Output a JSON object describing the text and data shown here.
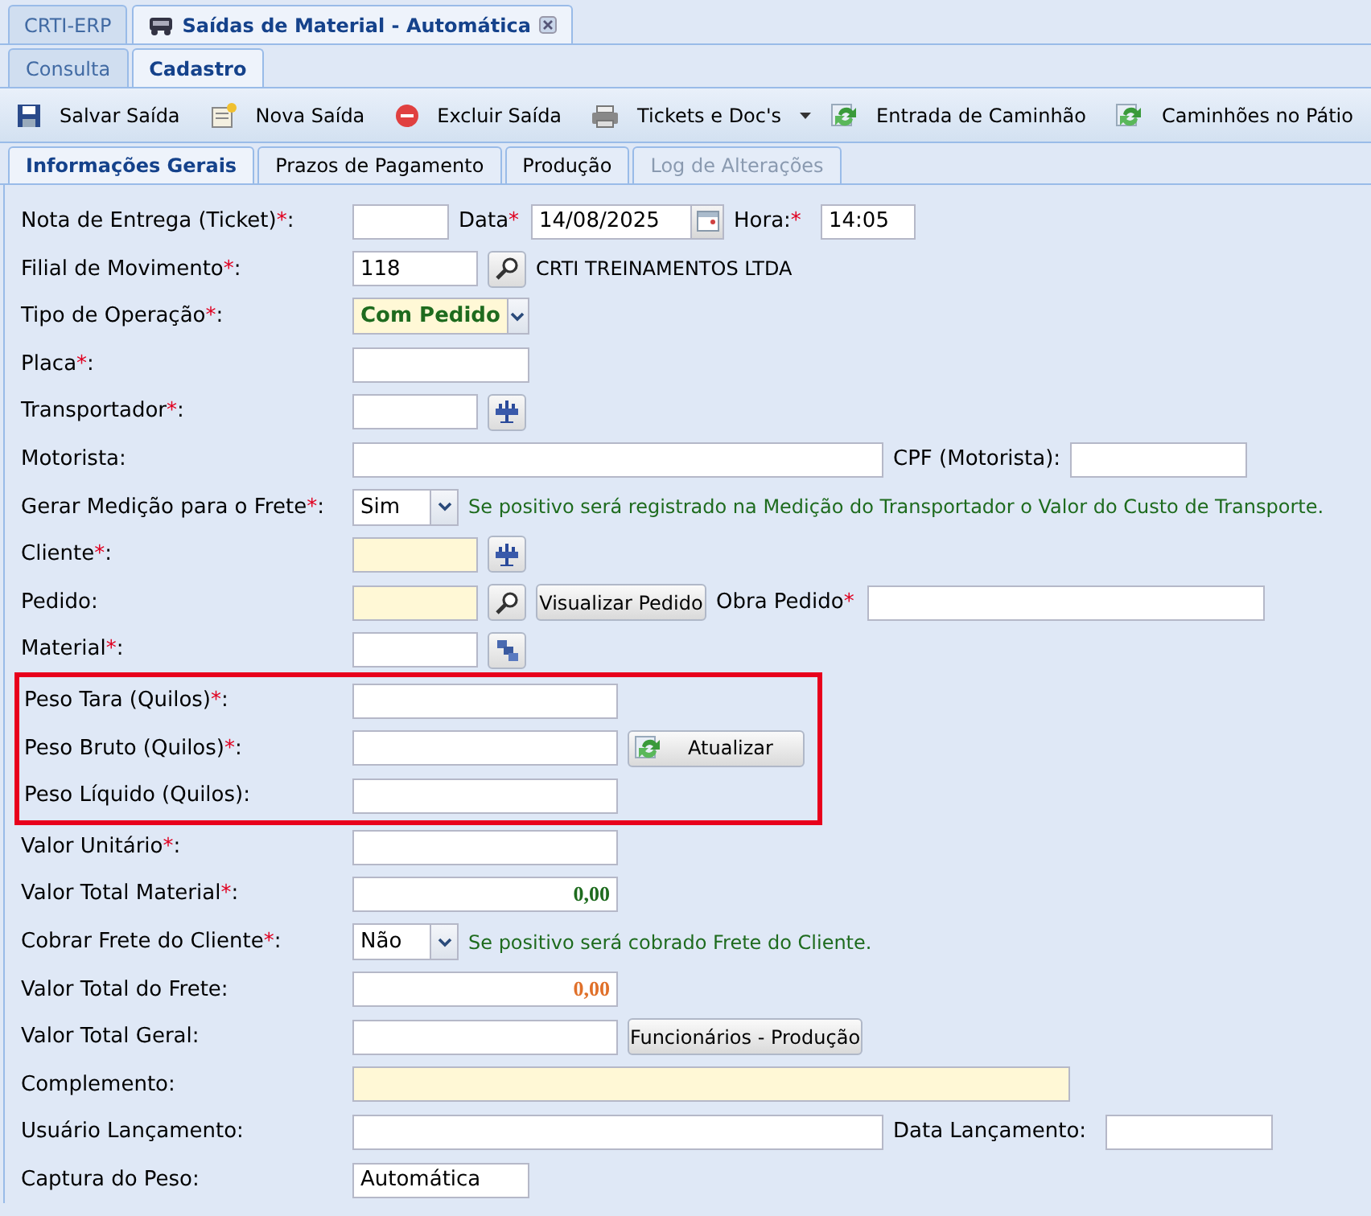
{
  "app_tabs": [
    {
      "label": "CRTI-ERP",
      "selected": false,
      "closable": false
    },
    {
      "label": "Saídas de Material - Automática",
      "selected": true,
      "closable": true
    }
  ],
  "mode_tabs": [
    {
      "label": "Consulta",
      "selected": false
    },
    {
      "label": "Cadastro",
      "selected": true
    }
  ],
  "toolbar": [
    {
      "kind": "save",
      "label": "Salvar Saída",
      "dropdown": false
    },
    {
      "kind": "new",
      "label": "Nova Saída",
      "dropdown": false
    },
    {
      "kind": "delete",
      "label": "Excluir Saída",
      "dropdown": false
    },
    {
      "kind": "print",
      "label": "Tickets e Doc's",
      "dropdown": true
    },
    {
      "kind": "refresh",
      "label": "Entrada de Caminhão",
      "dropdown": false
    },
    {
      "kind": "refresh",
      "label": "Caminhões no Pátio",
      "dropdown": false
    }
  ],
  "form_tabs": [
    {
      "label": "Informações Gerais",
      "selected": true,
      "disabled": false
    },
    {
      "label": "Prazos de Pagamento",
      "selected": false,
      "disabled": false
    },
    {
      "label": "Produção",
      "selected": false,
      "disabled": false
    },
    {
      "label": "Log de Alterações",
      "selected": false,
      "disabled": true
    }
  ],
  "sections": [
    {
      "kind": "plain",
      "rows": [
        {
          "label": "Nota de Entrega (Ticket)",
          "mark": "*",
          "suffix": ":",
          "items": [
            {
              "kind": "input"
            },
            {
              "kind": "label",
              "text": "Data",
              "mark": "*"
            },
            {
              "kind": "date",
              "value": "14/08/2025"
            },
            {
              "kind": "label",
              "text": "Hora:",
              "mark": "*"
            },
            {
              "kind": "input",
              "value": "14:05"
            }
          ]
        },
        {
          "label": "Filial de Movimento",
          "mark": "*",
          "suffix": ":",
          "items": [
            {
              "kind": "input",
              "value": "118"
            },
            {
              "kind": "search"
            },
            {
              "kind": "text",
              "text": "CRTI TREINAMENTOS LTDA"
            }
          ]
        },
        {
          "label": "Tipo de Operação",
          "mark": "*",
          "suffix": ":",
          "items": [
            {
              "kind": "select",
              "value": "Com Pedido",
              "highlighted": true,
              "color": "#1e6b1e"
            }
          ]
        },
        {
          "label": "Placa",
          "mark": "*",
          "suffix": ":",
          "items": [
            {
              "kind": "input"
            }
          ]
        },
        {
          "label": "Transportador",
          "mark": "*",
          "suffix": ":",
          "items": [
            {
              "kind": "input"
            },
            {
              "kind": "hierarchy"
            }
          ]
        },
        {
          "label": "Motorista:",
          "items": [
            {
              "kind": "input"
            },
            {
              "kind": "label",
              "text": "CPF (Motorista):"
            },
            {
              "kind": "input"
            }
          ]
        },
        {
          "label": "Gerar Medição para o Frete",
          "mark": "*",
          "suffix": ":",
          "items": [
            {
              "kind": "select",
              "value": "Sim",
              "highlighted": false
            },
            {
              "kind": "note",
              "text": "Se positivo será registrado na Medição do Transportador o Valor do Custo de Transporte."
            }
          ]
        },
        {
          "label": "Cliente",
          "mark": "*",
          "suffix": ":",
          "items": [
            {
              "kind": "input",
              "highlighted": true
            },
            {
              "kind": "hierarchy"
            }
          ]
        },
        {
          "label": "Pedido:",
          "items": [
            {
              "kind": "input",
              "highlighted": true
            },
            {
              "kind": "search"
            },
            {
              "kind": "button",
              "text": "Visualizar Pedido"
            },
            {
              "kind": "label",
              "text": "Obra Pedido",
              "mark": "*"
            },
            {
              "kind": "input"
            }
          ]
        },
        {
          "label": "Material",
          "mark": "*",
          "suffix": ":",
          "items": [
            {
              "kind": "input"
            },
            {
              "kind": "items"
            }
          ]
        }
      ]
    },
    {
      "kind": "outlined",
      "rows": [
        {
          "label": "Peso Tara (Quilos)",
          "mark": "*",
          "suffix": ":",
          "items": [
            {
              "kind": "input"
            }
          ]
        },
        {
          "label": "Peso Bruto (Quilos)",
          "mark": "*",
          "suffix": ":",
          "items": [
            {
              "kind": "input"
            },
            {
              "kind": "refresh-button",
              "text": "Atualizar"
            }
          ]
        },
        {
          "label": "Peso Líquido (Quilos):",
          "items": [
            {
              "kind": "input"
            }
          ]
        }
      ]
    },
    {
      "kind": "plain",
      "rows": [
        {
          "label": "Valor Unitário",
          "mark": "*",
          "suffix": ":",
          "items": [
            {
              "kind": "input"
            }
          ]
        },
        {
          "label": "Valor Total Material",
          "mark": "*",
          "suffix": ":",
          "items": [
            {
              "kind": "amount",
              "value": "0,00",
              "color": "#1e6b1e"
            }
          ]
        },
        {
          "label": "Cobrar Frete do Cliente",
          "mark": "*",
          "suffix": ":",
          "items": [
            {
              "kind": "select",
              "value": "Não",
              "highlighted": false
            },
            {
              "kind": "note",
              "text": "Se positivo será cobrado Frete do Cliente."
            }
          ]
        },
        {
          "label": "Valor Total do Frete:",
          "items": [
            {
              "kind": "amount",
              "value": "0,00",
              "color": "#e0702a"
            }
          ]
        },
        {
          "label": "Valor Total Geral:",
          "items": [
            {
              "kind": "input"
            },
            {
              "kind": "button",
              "text": "Funcionários - Produção"
            }
          ]
        },
        {
          "label": "Complemento:",
          "items": [
            {
              "kind": "input",
              "highlighted": true
            }
          ]
        },
        {
          "label": "Usuário Lançamento:",
          "items": [
            {
              "kind": "input"
            },
            {
              "kind": "label",
              "text": "Data Lançamento:"
            },
            {
              "kind": "input"
            }
          ]
        },
        {
          "label": "Captura do Peso:",
          "items": [
            {
              "kind": "input",
              "value": "Automática"
            }
          ]
        }
      ]
    }
  ]
}
